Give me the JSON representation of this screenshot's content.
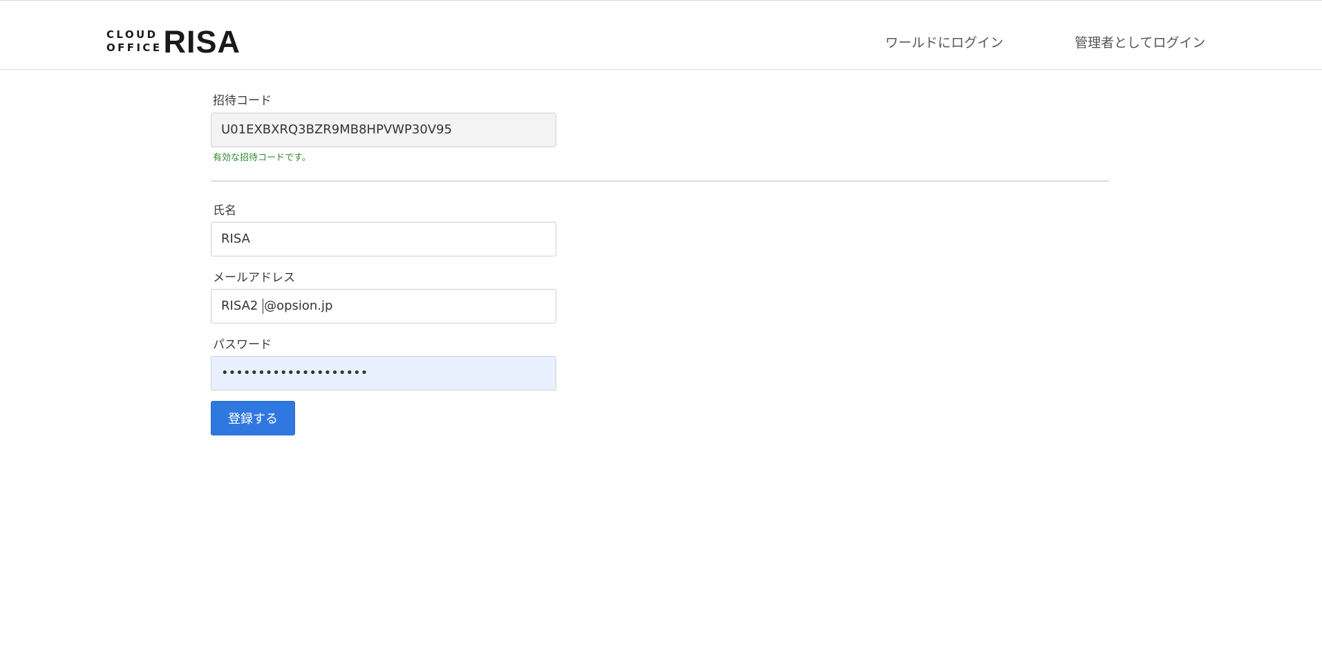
{
  "header": {
    "logo_small_line1": "CLOUD",
    "logo_small_line2": "OFFICE",
    "logo_big": "RISA",
    "nav_world_login": "ワールドにログイン",
    "nav_admin_login": "管理者としてログイン"
  },
  "form": {
    "invite_code": {
      "label": "招待コード",
      "value": "U01EXBXRQ3BZR9MB8HPVWP30V95",
      "valid_message": "有効な招待コードです。"
    },
    "name": {
      "label": "氏名",
      "value": "RISA"
    },
    "email": {
      "label": "メールアドレス",
      "value_before_caret": "RISA2 ",
      "value_after_caret": "@opsion.jp"
    },
    "password": {
      "label": "パスワード",
      "value": "••••••••••••••••••••"
    },
    "submit_label": "登録する"
  },
  "colors": {
    "primary_button": "#2f78e0",
    "valid_text": "#2e8b2e",
    "readonly_bg": "#f3f3f3",
    "autofill_bg": "#e8f0fe"
  }
}
